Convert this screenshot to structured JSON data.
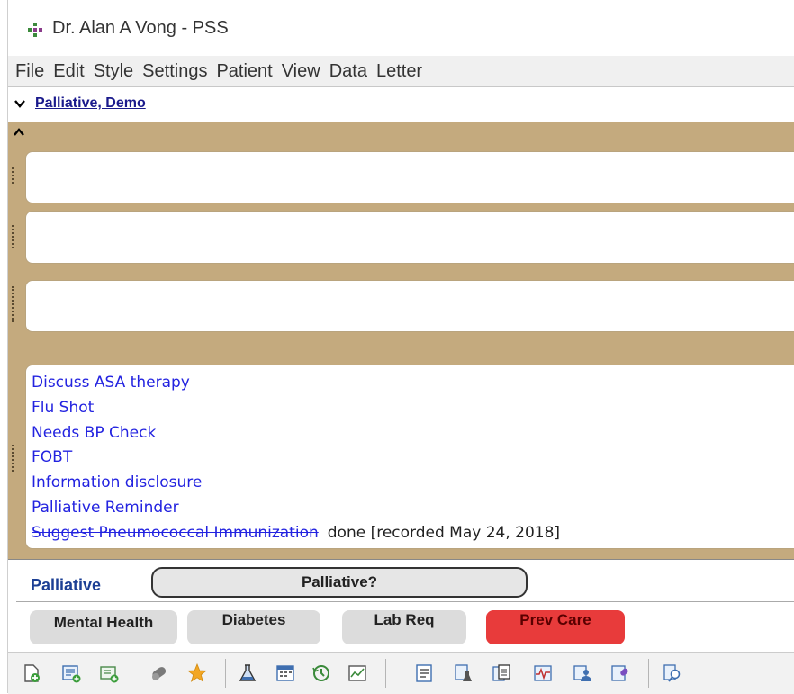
{
  "window": {
    "title": "Dr. Alan A Vong - PSS"
  },
  "menu": {
    "items": [
      "File",
      "Edit",
      "Style",
      "Settings",
      "Patient",
      "View",
      "Data",
      "Letter"
    ]
  },
  "patient": {
    "name": "Palliative, Demo"
  },
  "reminders": {
    "items": [
      "Discuss ASA therapy",
      "Flu Shot",
      "Needs BP Check",
      "FOBT",
      "Information disclosure",
      "Palliative Reminder"
    ],
    "done_item": {
      "label": "Suggest Pneumococcal Immunization",
      "note": "done [recorded May 24, 2018]"
    }
  },
  "bottom": {
    "palliative_label": "Palliative",
    "palliative_button": "Palliative?",
    "buttons": {
      "mental_health": "Mental Health",
      "diabetes": "Diabetes",
      "lab_req": "Lab Req",
      "prev_care": "Prev Care"
    }
  },
  "colors": {
    "panel_background": "#c4aa7e",
    "reminder_text": "#2323e0",
    "prev_care": "#e83b3b",
    "palliative_label": "#1c3f94"
  },
  "toolbar": {
    "icons": [
      "new-document-icon",
      "add-note-icon",
      "add-form-icon",
      "pills-icon",
      "star-icon",
      "flask-icon",
      "calendar-icon",
      "history-icon",
      "chart-icon",
      "list-icon",
      "lab-report-icon",
      "document-stack-icon",
      "vitals-icon",
      "people-icon",
      "prescription-icon",
      "search-doc-icon"
    ]
  }
}
